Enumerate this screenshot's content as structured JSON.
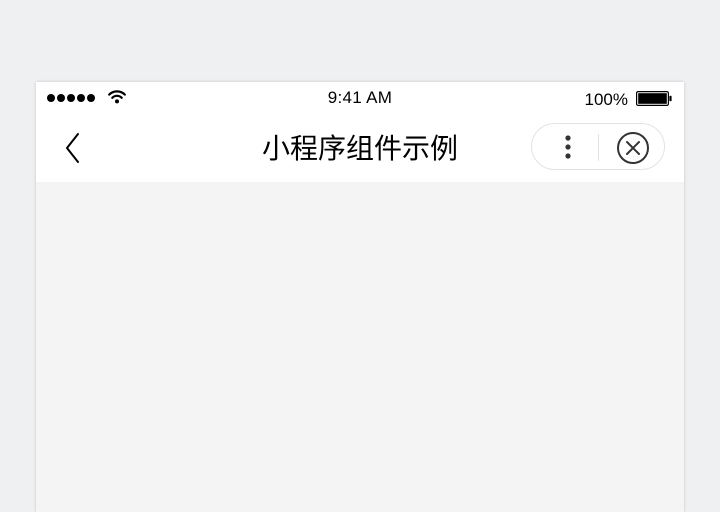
{
  "status_bar": {
    "time": "9:41 AM",
    "battery_percent": "100%",
    "signal_bars": 5,
    "icons": [
      "signal-dots-icon",
      "wifi-icon",
      "battery-icon"
    ]
  },
  "nav_bar": {
    "title": "小程序组件示例",
    "back_icon": "chevron-left-icon",
    "capsule": {
      "more_icon": "more-vertical-icon",
      "close_icon": "close-circle-icon"
    }
  },
  "colors": {
    "page_background": "#eff0f2",
    "content_background": "#f4f4f4",
    "bar_background": "#ffffff",
    "capsule_border": "#e3e3e3",
    "icon_color": "#333333"
  }
}
